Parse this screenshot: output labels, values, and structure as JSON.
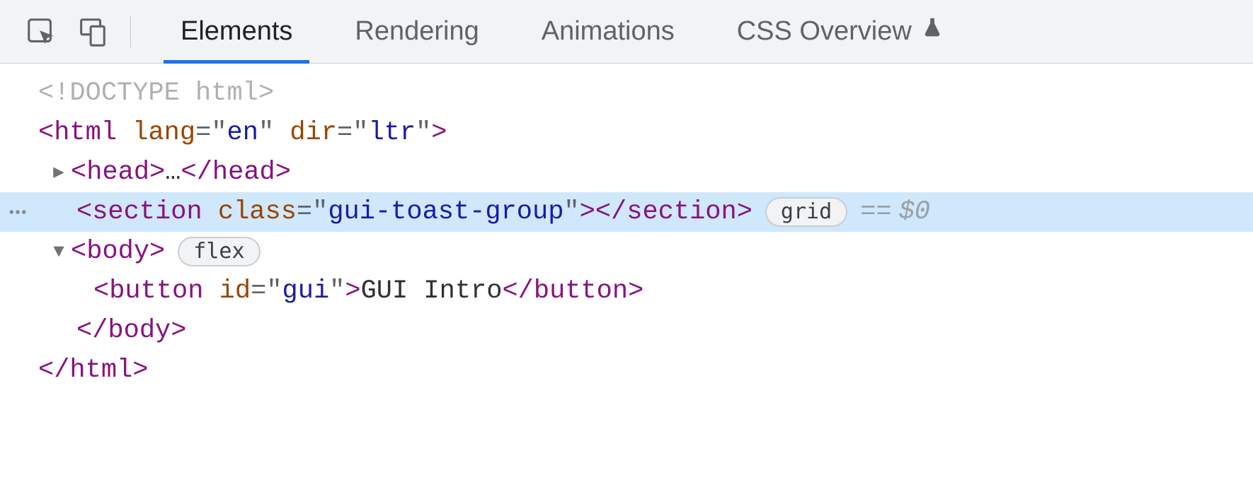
{
  "toolbar": {
    "tabs": [
      "Elements",
      "Rendering",
      "Animations",
      "CSS Overview"
    ],
    "activeTab": "Elements"
  },
  "dom": {
    "doctype": "<!DOCTYPE html>",
    "lines": [
      {
        "tag_open": "html",
        "attrs": [
          {
            "name": "lang",
            "value": "en"
          },
          {
            "name": "dir",
            "value": "ltr"
          }
        ]
      },
      {
        "collapsed": true,
        "tag": "head",
        "ellipsis": "…"
      },
      {
        "selected": true,
        "tag": "section",
        "attrs": [
          {
            "name": "class",
            "value": "gui-toast-group"
          }
        ],
        "selfclose_text": "",
        "badge": "grid",
        "ref": "== $0"
      },
      {
        "expanded": true,
        "tag": "body",
        "badge": "flex"
      },
      {
        "tag": "button",
        "attrs": [
          {
            "name": "id",
            "value": "gui"
          }
        ],
        "inner_text": " GUI Intro "
      },
      {
        "close": "body"
      },
      {
        "close": "html"
      }
    ]
  }
}
